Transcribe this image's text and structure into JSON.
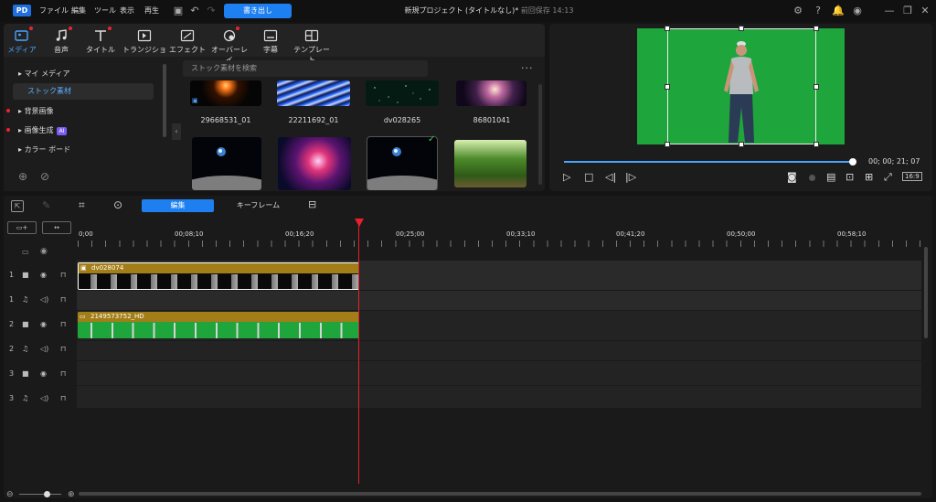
{
  "menu": [
    "ファイル",
    "編集",
    "ツール",
    "表示",
    "再生"
  ],
  "export_label": "書き出し",
  "project": {
    "title": "新規プロジェクト (タイトルなし)*",
    "saved": "前回保存 14:13"
  },
  "tabs": [
    {
      "label": "メディア",
      "icon": "media-icon"
    },
    {
      "label": "音声",
      "icon": "music-note-icon"
    },
    {
      "label": "タイトル",
      "icon": "text-icon"
    },
    {
      "label": "トランジション",
      "icon": "transition-icon"
    },
    {
      "label": "エフェクト",
      "icon": "effect-icon"
    },
    {
      "label": "オーバーレイ",
      "icon": "overlay-icon"
    },
    {
      "label": "字幕",
      "icon": "subtitle-icon"
    },
    {
      "label": "テンプレート",
      "icon": "template-icon"
    }
  ],
  "sidebar": {
    "items": [
      {
        "label": "マイ メディア",
        "arrow": "▸"
      },
      {
        "label": "ストック素材",
        "active": true
      },
      {
        "label": "背景画像",
        "arrow": "▸"
      },
      {
        "label": "画像生成",
        "arrow": "▸",
        "badge": "AI"
      },
      {
        "label": "カラー ボード",
        "arrow": "▸"
      }
    ]
  },
  "search": {
    "placeholder": "ストック素材を検索"
  },
  "media_row1": [
    {
      "caption": "29668531_01"
    },
    {
      "caption": "22211692_01"
    },
    {
      "caption": "dv028265"
    },
    {
      "caption": "86801041"
    }
  ],
  "preview": {
    "timecode": "00; 00; 21; 07",
    "aspect": "16:9"
  },
  "timeline_tabs": {
    "edit": "編集",
    "keyframe": "キーフレーム"
  },
  "ruler": [
    "0;00",
    "00;08;10",
    "00;16;20",
    "00;25;00",
    "00;33;10",
    "00;41;20",
    "00;50;00",
    "00;58;10"
  ],
  "tracks": [
    {
      "num": "1",
      "type": "video"
    },
    {
      "num": "1",
      "type": "audio"
    },
    {
      "num": "2",
      "type": "video"
    },
    {
      "num": "2",
      "type": "audio"
    },
    {
      "num": "3",
      "type": "video"
    },
    {
      "num": "3",
      "type": "audio"
    }
  ],
  "clips": {
    "clip1": "dv028074",
    "clip2": "2149573752_HD"
  },
  "colors": {
    "accent": "#1e7ff0",
    "chroma_green": "#1ea53b",
    "clip_gold": "#a37d17",
    "playhead": "#e8202a"
  }
}
